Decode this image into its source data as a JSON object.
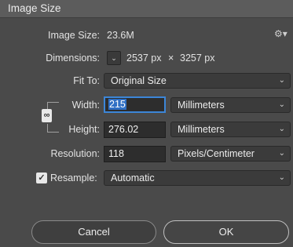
{
  "window": {
    "title": "Image Size"
  },
  "image_size": {
    "label": "Image Size:",
    "value": "23.6M"
  },
  "settings_icon": "gear-icon",
  "dimensions": {
    "label": "Dimensions:",
    "dropdown_icon": "chevron-down-icon",
    "width_value": "2537 px",
    "separator": "×",
    "height_value": "3257 px"
  },
  "fit_to": {
    "label": "Fit To:",
    "selected": "Original Size"
  },
  "width": {
    "label": "Width:",
    "value": "215",
    "unit": "Millimeters"
  },
  "height": {
    "label": "Height:",
    "value": "276.02",
    "unit": "Millimeters"
  },
  "constrain_icon": "link-icon",
  "resolution": {
    "label": "Resolution:",
    "value": "118",
    "unit": "Pixels/Centimeter"
  },
  "resample": {
    "label": "Resample:",
    "checked": true,
    "selected": "Automatic"
  },
  "buttons": {
    "cancel": "Cancel",
    "ok": "OK"
  },
  "colors": {
    "background": "#4a4a4a",
    "focus_ring": "#3c86d8",
    "selection": "#2f6fc4"
  }
}
